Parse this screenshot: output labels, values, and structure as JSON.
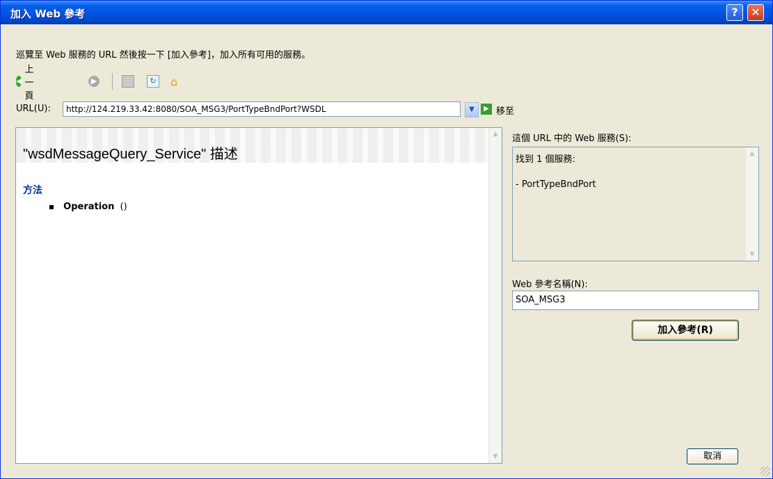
{
  "window": {
    "title": "加入 Web 參考",
    "help_label": "?",
    "close_label": "✕"
  },
  "instruction": "巡覽至 Web 服務的 URL 然後按一下 [加入參考]，加入所有可用的服務。",
  "toolbar": {
    "back_label": "上一頁",
    "back_icon": "back-arrow-icon",
    "forward_icon": "forward-arrow-icon",
    "stop_icon": "stop-icon",
    "refresh_icon": "refresh-icon",
    "home_icon": "home-icon"
  },
  "url_bar": {
    "label": "URL(U):",
    "value": "http://124.219.33.42:8080/SOA_MSG3/PortTypeBndPort?WSDL",
    "go_label": "移至"
  },
  "document": {
    "title": "\"wsdMessageQuery_Service\" 描述",
    "section_heading": "方法",
    "methods": [
      {
        "name": "Operation",
        "signature": "()"
      }
    ]
  },
  "services_panel": {
    "label": "這個 URL 中的 Web 服務(S):",
    "found_text": "找到 1 個服務:",
    "items": [
      "- PortTypeBndPort"
    ]
  },
  "reference_name": {
    "label": "Web 參考名稱(N):",
    "value": "SOA_MSG3"
  },
  "buttons": {
    "add_reference": "加入參考(R)",
    "cancel": "取消"
  },
  "colors": {
    "titlebar": "#0054e3",
    "dialog_bg": "#ece9d8",
    "heading_blue": "#003399"
  }
}
